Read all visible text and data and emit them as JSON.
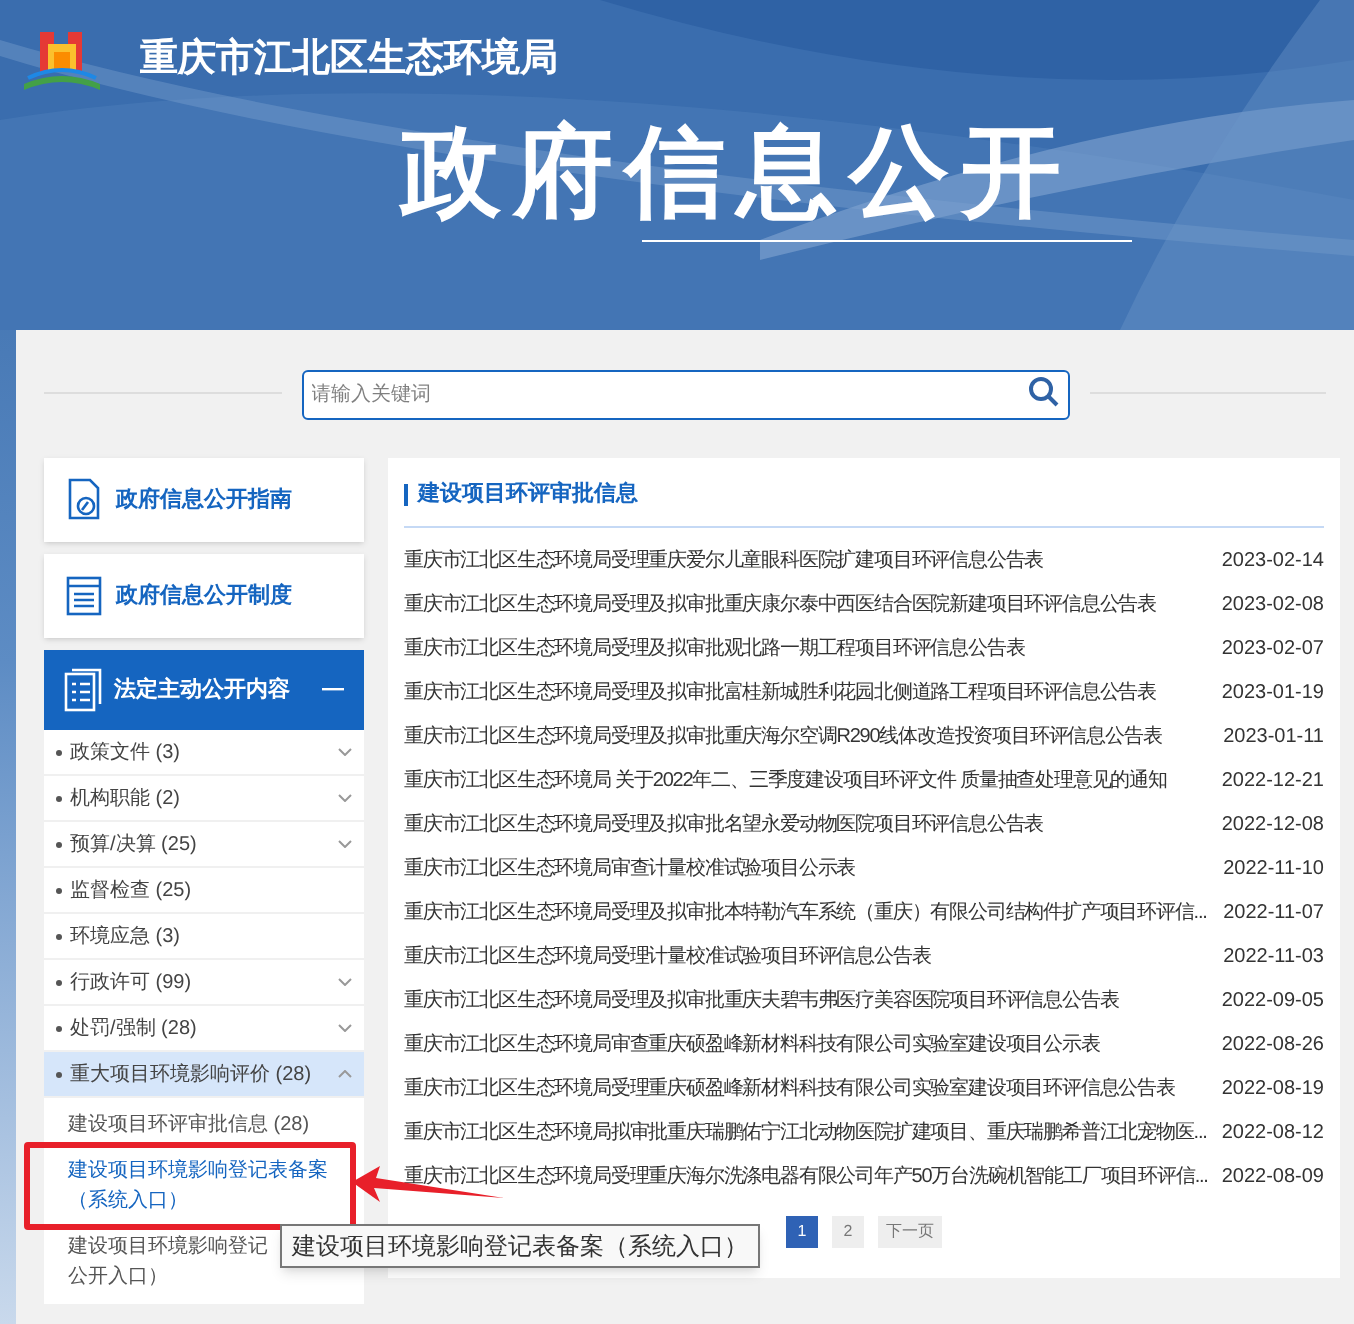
{
  "header": {
    "agency": "重庆市江北区生态环境局",
    "title": "政府信息公开"
  },
  "search": {
    "placeholder": "请输入关键词"
  },
  "sidebar": {
    "cards": [
      {
        "label": "政府信息公开指南",
        "kind": "guide"
      },
      {
        "label": "政府信息公开制度",
        "kind": "rules"
      }
    ],
    "section": {
      "label": "法定主动公开内容",
      "expanded": true,
      "items": [
        {
          "label": "政策文件 (3)",
          "expandable": true,
          "expanded": false
        },
        {
          "label": "机构职能 (2)",
          "expandable": true,
          "expanded": false
        },
        {
          "label": "预算/决算 (25)",
          "expandable": true,
          "expanded": false
        },
        {
          "label": "监督检查 (25)",
          "expandable": false,
          "expanded": false
        },
        {
          "label": "环境应急 (3)",
          "expandable": false,
          "expanded": false
        },
        {
          "label": "行政许可 (99)",
          "expandable": true,
          "expanded": false
        },
        {
          "label": "处罚/强制 (28)",
          "expandable": true,
          "expanded": false
        },
        {
          "label": "重大项目环境影响评价 (28)",
          "expandable": true,
          "expanded": true,
          "children": [
            {
              "lines": [
                "建设项目环评审批信息 (28)"
              ],
              "selected": false,
              "highlighted": false
            },
            {
              "lines": [
                "建设项目环境影响登记表备案（系统入口）"
              ],
              "selected": true,
              "highlighted": true
            },
            {
              "lines": [
                "建设项目环境影响登记",
                "公开入口）"
              ],
              "selected": false,
              "highlighted": false
            }
          ]
        }
      ]
    }
  },
  "tooltip": {
    "text": "建设项目环境影响登记表备案（系统入口）"
  },
  "panel": {
    "title": "建设项目环评审批信息",
    "rows": [
      {
        "title": "重庆市江北区生态环境局受理重庆爱尔儿童眼科医院扩建项目环评信息公告表",
        "date": "2023-02-14"
      },
      {
        "title": "重庆市江北区生态环境局受理及拟审批重庆康尔泰中西医结合医院新建项目环评信息公告表",
        "date": "2023-02-08"
      },
      {
        "title": "重庆市江北区生态环境局受理及拟审批观北路一期工程项目环评信息公告表",
        "date": "2023-02-07"
      },
      {
        "title": "重庆市江北区生态环境局受理及拟审批富桂新城胜利花园北侧道路工程项目环评信息公告表",
        "date": "2023-01-19"
      },
      {
        "title": "重庆市江北区生态环境局受理及拟审批重庆海尔空调R290线体改造投资项目环评信息公告表",
        "date": "2023-01-11"
      },
      {
        "title": "重庆市江北区生态环境局 关于2022年二、三季度建设项目环评文件 质量抽查处理意见的通知",
        "date": "2022-12-21"
      },
      {
        "title": "重庆市江北区生态环境局受理及拟审批名望永爱动物医院项目环评信息公告表",
        "date": "2022-12-08"
      },
      {
        "title": "重庆市江北区生态环境局审查计量校准试验项目公示表",
        "date": "2022-11-10"
      },
      {
        "title": "重庆市江北区生态环境局受理及拟审批本特勒汽车系统（重庆）有限公司结构件扩产项目环评信...",
        "date": "2022-11-07"
      },
      {
        "title": "重庆市江北区生态环境局受理计量校准试验项目环评信息公告表",
        "date": "2022-11-03"
      },
      {
        "title": "重庆市江北区生态环境局受理及拟审批重庆夫碧韦弗医疗美容医院项目环评信息公告表",
        "date": "2022-09-05"
      },
      {
        "title": "重庆市江北区生态环境局审查重庆硕盈峰新材料科技有限公司实验室建设项目公示表",
        "date": "2022-08-26"
      },
      {
        "title": "重庆市江北区生态环境局受理重庆硕盈峰新材料科技有限公司实验室建设项目环评信息公告表",
        "date": "2022-08-19"
      },
      {
        "title": "重庆市江北区生态环境局拟审批重庆瑞鹏佑宁江北动物医院扩建项目、重庆瑞鹏希普江北宠物医...",
        "date": "2022-08-12"
      },
      {
        "title": "重庆市江北区生态环境局受理重庆海尔洗涤电器有限公司年产50万台洗碗机智能工厂项目环评信...",
        "date": "2022-08-09"
      }
    ],
    "pagination": [
      {
        "label": "1",
        "selected": true
      },
      {
        "label": "2",
        "selected": false
      },
      {
        "label": "下一页",
        "selected": false
      }
    ]
  }
}
